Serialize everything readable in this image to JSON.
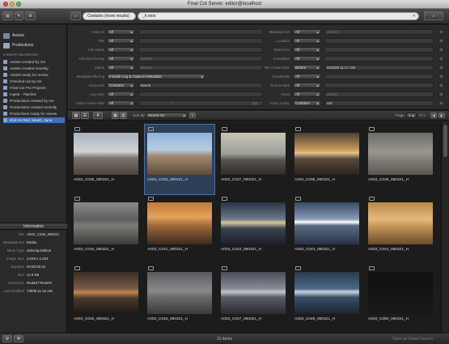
{
  "window": {
    "title": "Final Cut Server: editor@localhost"
  },
  "toolbar": {
    "scope": "Contains (more results)",
    "search_value": "_h.mov"
  },
  "sidebar": {
    "nav": [
      {
        "label": "Assets"
      },
      {
        "label": "Productions"
      }
    ],
    "smart_header": "SMART SEARCHES",
    "smart_searches": [
      "Assets created by me",
      "Assets created recently",
      "Assets ready for review",
      "Checked out by me",
      "Final Cut Pro Projects",
      "Ingest - Pipeline",
      "Productions created by me",
      "Productions created recently",
      "Productions ready for review",
      "shot on Red, beach, June"
    ],
    "selected_index": 9
  },
  "info": {
    "header": "Information",
    "rows": [
      {
        "k": "Title",
        "v": "A003_C036_080321"
      },
      {
        "k": "Metadata Set",
        "v": "Media"
      },
      {
        "k": "Mime Type",
        "v": "video/quicktime"
      },
      {
        "k": "Image Size",
        "v": "2,048 x 1,024"
      },
      {
        "k": "Duration",
        "v": "00:00:50:22"
      },
      {
        "k": "Size",
        "v": "11.8 KB"
      },
      {
        "k": "Stored On",
        "v": "Red4K7Tests#2"
      },
      {
        "k": "Last Modified",
        "v": "7/8/08 11:34 AM"
      }
    ]
  },
  "search": {
    "left": [
      {
        "label": "Asset ID",
        "op": "All",
        "val": ""
      },
      {
        "label": "Title",
        "op": "All",
        "val": ""
      },
      {
        "label": "File Name",
        "op": "All",
        "val": ""
      },
      {
        "label": "Checked Out By",
        "op": "All",
        "val": "(None)"
      },
      {
        "label": "Status",
        "op": "All",
        "val": "(None)"
      },
      {
        "label": "Metadata Filtering",
        "op": "Include Log & Capture Metadata",
        "val": ""
      },
      {
        "label": "Keywords",
        "op": "Contains",
        "val": "beach"
      },
      {
        "label": "Log Note",
        "op": "All",
        "val": ""
      },
      {
        "label": "Video Frame Rate",
        "op": "All",
        "val": ""
      }
    ],
    "right": [
      {
        "label": "Metadata Set",
        "op": "All",
        "val": "(None)"
      },
      {
        "label": "Location",
        "op": "All",
        "val": ""
      },
      {
        "label": "Stored On",
        "op": "All",
        "val": ""
      },
      {
        "label": "Annotation",
        "op": "All",
        "val": ""
      },
      {
        "label": "File Create Date",
        "op": "Before",
        "val": "6/25/08 11:27 AM"
      },
      {
        "label": "Created By",
        "op": "All",
        "val": ""
      },
      {
        "label": "Sent to Web",
        "op": "All",
        "val": ""
      },
      {
        "label": "Good",
        "op": "All",
        "val": "(None)"
      },
      {
        "label": "Video Codec",
        "op": "Contains",
        "val": "red"
      }
    ],
    "fps_sep": "/",
    "fps_unit": "fps"
  },
  "browser": {
    "sort_label": "Sort By",
    "sort_value": "Stored On",
    "page_label": "Page",
    "page": "1",
    "page_of": "of 1"
  },
  "tiles": [
    "A003_C035_080321_H",
    "A003_C036_080321_H",
    "A003_C037_080321_H",
    "A003_C038_080321_H",
    "A003_C039_080321_H",
    "A003_C040_080321_H",
    "A003_C041_080321_H",
    "A003_C042_080321_H",
    "A003_C043_080321_H",
    "A003_C044_080321_H",
    "A003_C045_080321_H",
    "A003_C046_080321_H",
    "A003_C047_080321_H",
    "A003_C049_080321_H",
    "A003_C050_080321_H"
  ],
  "selected_tile": 1,
  "status": {
    "count": "31 items",
    "save": "Save as Smart Search"
  },
  "colors": {
    "accent": "#3d6fc2",
    "background": "#1f1f1f"
  }
}
